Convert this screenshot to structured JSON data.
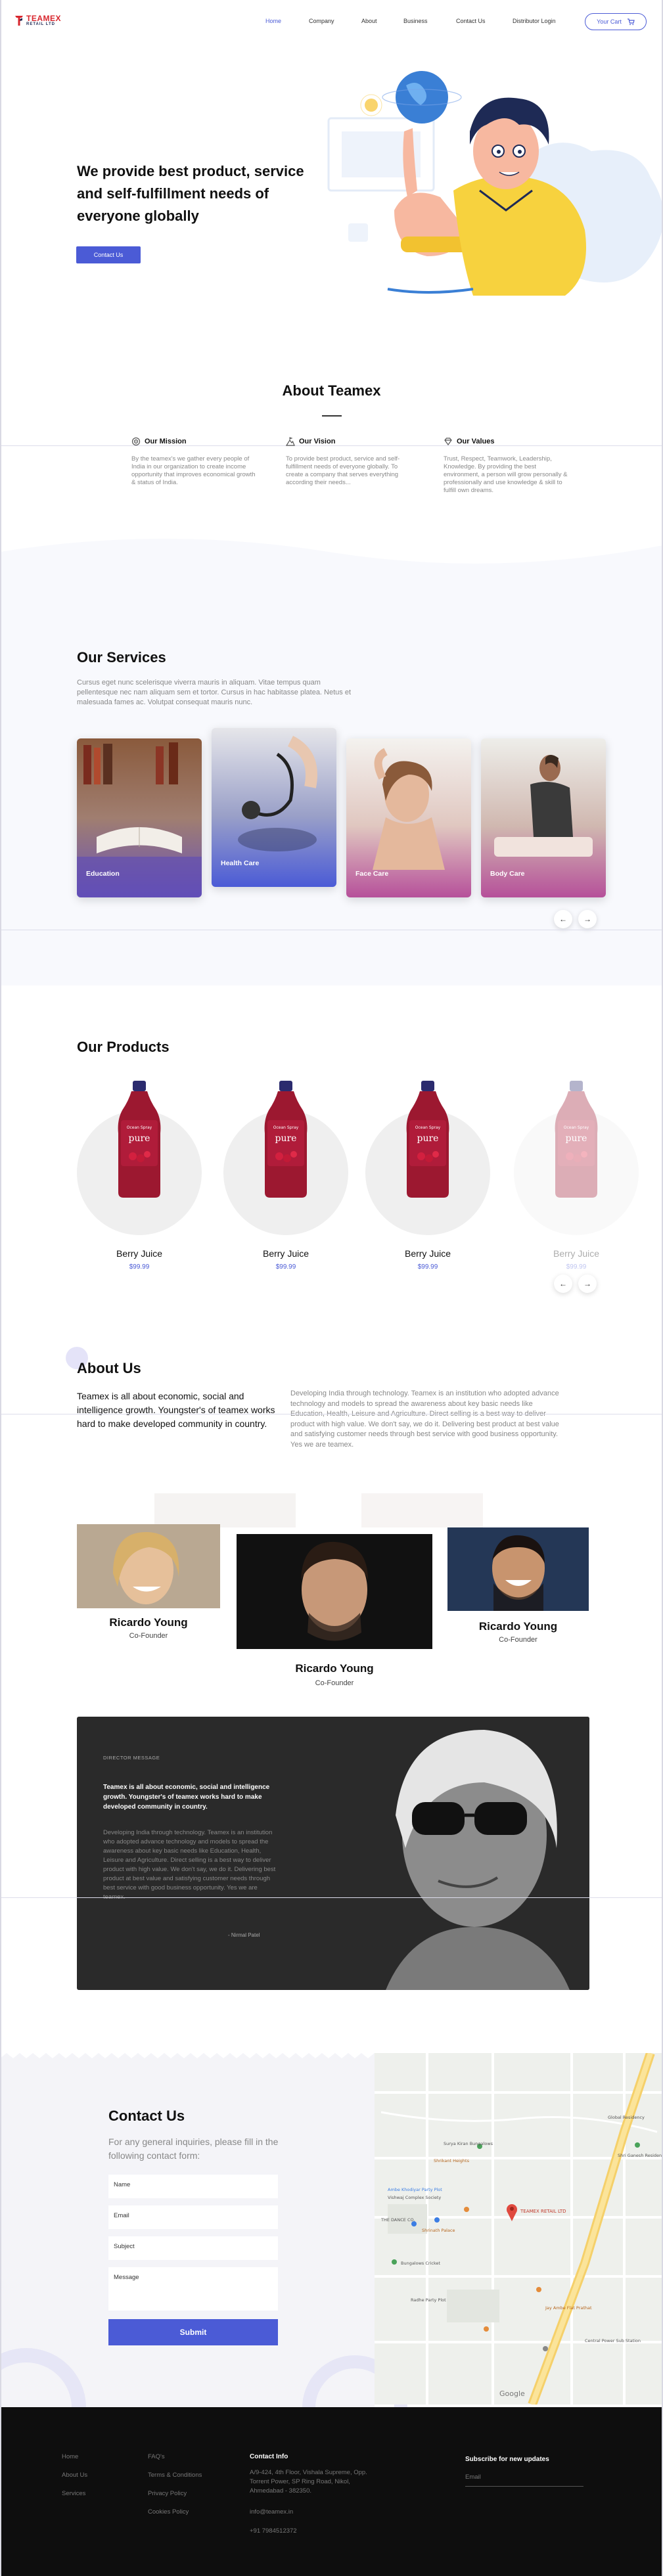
{
  "header": {
    "logo": {
      "name": "TEAMEX",
      "sub": "RETAIL LTD"
    },
    "nav": [
      "Home",
      "Company",
      "About",
      "Business",
      "Contact Us",
      "Distributor Login"
    ],
    "cart_label": "Your Cart"
  },
  "hero": {
    "title": "We provide best product, service and self-fulfillment needs of everyone globally",
    "button": "Contact Us"
  },
  "about_teamex": {
    "title": "About Teamex",
    "features": [
      {
        "icon": "target-icon",
        "title": "Our Mission",
        "text": "By the teamex's we gather every people of India in our organization to create income opportunity that improves economical growth & status of India."
      },
      {
        "icon": "mountain-flag-icon",
        "title": "Our Vision",
        "text": "To provide best product, service and self-fulfillment needs of everyone globally. To create a company that serves everything according their needs..."
      },
      {
        "icon": "diamond-icon",
        "title": "Our Values",
        "text": "Trust, Respect, Teamwork, Leadership, Knowledge. By providing the best environment, a person will grow personally & professionally and use knowledge & skill to fulfill own dreams."
      }
    ]
  },
  "services": {
    "title": "Our Services",
    "description": "Cursus eget nunc scelerisque viverra mauris in aliquam. Vitae tempus quam pellentesque nec nam aliquam sem et tortor. Cursus in hac habitasse platea. Netus et malesuada fames ac. Volutpat consequat mauris nunc.",
    "cards": [
      "Education",
      "Health Care",
      "Face Care",
      "Body Care"
    ],
    "prev": "←",
    "next": "→"
  },
  "products": {
    "title": "Our Products",
    "items": [
      {
        "name": "Berry Juice",
        "price": "$99.99"
      },
      {
        "name": "Berry Juice",
        "price": "$99.99"
      },
      {
        "name": "Berry Juice",
        "price": "$99.99"
      },
      {
        "name": "Berry Juice",
        "price": "$99.99"
      }
    ],
    "bottle_brand": "Ocean Spray",
    "bottle_label": "pure",
    "prev": "←",
    "next": "→"
  },
  "about_us": {
    "title": "About Us",
    "lead": "Teamex is all about economic, social and intelligence growth. Youngster's of teamex works hard to make developed community in country.",
    "body": "Developing India through technology. Teamex is an institution who adopted advance technology and models to spread the awareness about key basic needs like Education, Health, Leisure and Agriculture. Direct selling is a best way to deliver product with high value. We don't say, we do it. Delivering best product at best value and satisfying customer needs through best service with good business opportunity. Yes we are teamex."
  },
  "team": [
    {
      "name": "Ricardo Young",
      "role": "Co-Founder"
    },
    {
      "name": "Ricardo Young",
      "role": "Co-Founder"
    },
    {
      "name": "Ricardo Young",
      "role": "Co-Founder"
    }
  ],
  "director": {
    "label": "DIRECTOR MESSAGE",
    "lead": "Teamex is all about economic, social and intelligence growth. Youngster's of teamex works hard to make developed community in country.",
    "body": "Developing India through technology. Teamex is an institution who adopted advance technology and models to spread the awareness about key basic needs like Education, Health, Leisure and Agriculture. Direct selling is a best way to deliver product with high value. We don't say, we do it. Delivering best product at best value and satisfying customer needs through best service with good business opportunity. Yes we are teamex.",
    "signature": "- Nirmal Patel"
  },
  "contact": {
    "title": "Contact Us",
    "description": "For any general inquiries, please fill in the following contact form:",
    "fields": {
      "name": "Name",
      "email": "Email",
      "subject": "Subject",
      "message": "Message"
    },
    "submit": "Submit"
  },
  "map": {
    "pin_label": "TEAMEX RETAIL LTD",
    "places": [
      "Global Residency",
      "Surya Kiran Bungalows",
      "Shri Ganesh Residency",
      "Shrikant Heights",
      "Ambe Khodiyar Party Plot",
      "Vishwaj Complex Society",
      "THE DANCE CO.",
      "Shrinath Palace",
      "Bungalows Cricket",
      "Radhe Party Plot",
      "Jay Ambe Flat Prathat",
      "Central Power Sub Station"
    ],
    "google": "Google"
  },
  "footer": {
    "col1": [
      "Home",
      "About Us",
      "Services"
    ],
    "col2": [
      "FAQ's",
      "Terms & Conditions",
      "Privacy Policy",
      "Cookies Policy"
    ],
    "contact_title": "Contact Info",
    "address": "A/9-424, 4th Floor, Vishala Supreme, Opp. Torrent Power, SP Ring Road, Nikol, Ahmedabad - 382350.",
    "email": "info@teamex.in",
    "phone": "+91 7984512372",
    "subscribe_title": "Subscribe for new updates",
    "subscribe_placeholder": "Email"
  },
  "colors": {
    "accent": "#4b5bd6",
    "brand_red": "#d8262d",
    "footer_bg": "#0e0e0e",
    "director_bg": "#2a2a2a"
  }
}
